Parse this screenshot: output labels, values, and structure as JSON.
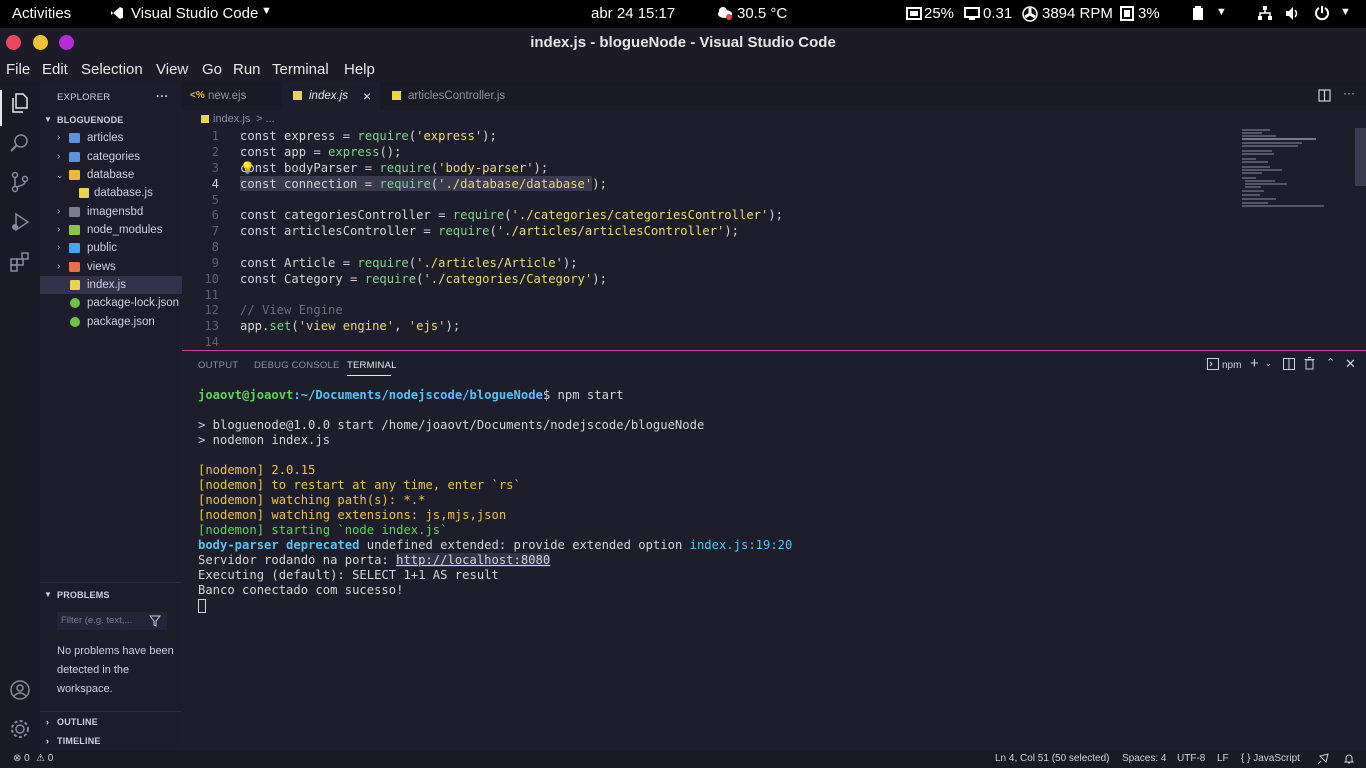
{
  "topbar": {
    "activities": "Activities",
    "app_name": "Visual Studio Code",
    "datetime": "abr 24  15:17",
    "temperature": "30.5 °C",
    "cpu": "25%",
    "load": "0.31",
    "fan": "3894 RPM",
    "mem": "3%"
  },
  "window": {
    "title": "index.js - blogueNode - Visual Studio Code"
  },
  "menu": [
    "File",
    "Edit",
    "Selection",
    "View",
    "Go",
    "Run",
    "Terminal",
    "Help"
  ],
  "sidebar": {
    "explorer_title": "EXPLORER",
    "more": "···",
    "project": "BLOGUENODE",
    "items": [
      {
        "label": "articles",
        "type": "folder",
        "icon": "folder-icon"
      },
      {
        "label": "categories",
        "type": "folder",
        "icon": "folder-icon"
      },
      {
        "label": "database",
        "type": "folder-open",
        "icon": "folder-icon"
      },
      {
        "label": "database.js",
        "type": "file",
        "icon": "js-file-icon"
      },
      {
        "label": "imagensbd",
        "type": "folder",
        "icon": "folder-icon"
      },
      {
        "label": "node_modules",
        "type": "folder",
        "icon": "node-folder-icon"
      },
      {
        "label": "public",
        "type": "folder",
        "icon": "folder-icon"
      },
      {
        "label": "views",
        "type": "folder",
        "icon": "views-folder-icon"
      },
      {
        "label": "index.js",
        "type": "file",
        "icon": "js-file-icon"
      },
      {
        "label": "package-lock.json",
        "type": "file",
        "icon": "node-file-icon"
      },
      {
        "label": "package.json",
        "type": "file",
        "icon": "node-file-icon"
      }
    ],
    "problems_title": "PROBLEMS",
    "filter_placeholder": "Filter (e.g. text,...",
    "problems_msg_1": "No problems have been",
    "problems_msg_2": "detected in the",
    "problems_msg_3": "workspace.",
    "outline_title": "OUTLINE",
    "timeline_title": "TIMELINE"
  },
  "tabs": [
    {
      "label": "new.ejs",
      "icon": "<%"
    },
    {
      "label": "index.js",
      "icon": "JS",
      "close": "×"
    },
    {
      "label": "articlesController.js",
      "icon": "JS"
    }
  ],
  "breadcrumb": {
    "file": "index.js",
    "rest": "> ..."
  },
  "code": {
    "line_numbers": [
      "1",
      "2",
      "3",
      "4",
      "5",
      "6",
      "7",
      "8",
      "9",
      "10",
      "11",
      "12",
      "13",
      "14"
    ],
    "current_line": "4"
  },
  "panel": {
    "tabs": [
      "OUTPUT",
      "DEBUG CONSOLE",
      "TERMINAL"
    ],
    "terminal_name": "npm",
    "prompt_user": "joaovt@joaovt",
    "prompt_path": ":~/Documents/nodejscode/blogueNode",
    "prompt_cmd": "$ npm start",
    "lines": {
      "l1": "> bloguenode@1.0.0 start /home/joaovt/Documents/nodejscode/blogueNode",
      "l2": "> nodemon index.js",
      "l3": "[nodemon] 2.0.15",
      "l4": "[nodemon] to restart at any time, enter `rs`",
      "l5": "[nodemon] watching path(s): *.*",
      "l6": "[nodemon] watching extensions: js,mjs,json",
      "l7": "[nodemon] starting `node index.js`",
      "dep_a": "body-parser deprecated",
      "dep_b": " undefined extended: provide extended option ",
      "dep_c": "index.js:19:20",
      "serv_a": "Servidor rodando na porta: ",
      "serv_b": "http://localhost:8080",
      "l9": "Executing (default): SELECT 1+1 AS result",
      "l10": "Banco conectado com sucesso!"
    }
  },
  "statusbar": {
    "errors": "⊗ 0",
    "warnings": "⚠ 0",
    "position": "Ln 4, Col 51 (50 selected)",
    "spaces": "Spaces: 4",
    "encoding": "UTF-8",
    "eol": "LF",
    "language": "{ }  JavaScript"
  },
  "colors": {
    "accent": "#d63aa4",
    "background": "#1e1d2b",
    "string": "#e6db74",
    "function": "#7fd18a"
  }
}
